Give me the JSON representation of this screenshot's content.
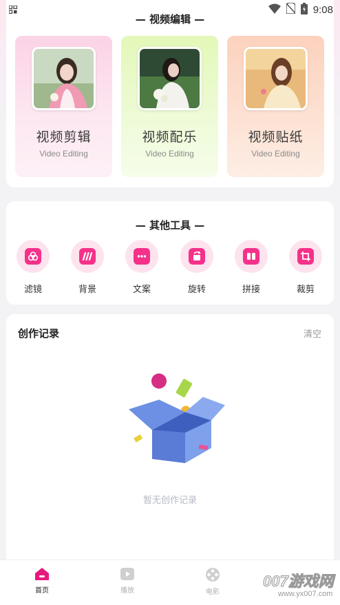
{
  "status_bar": {
    "time": "9:08",
    "icons": [
      "grid-icon",
      "wifi-icon",
      "no-sim-icon",
      "battery-icon"
    ]
  },
  "video_editing": {
    "title": "— 视频编辑 —",
    "features": [
      {
        "title": "视频剪辑",
        "subtitle": "Video Editing",
        "bg": "#fbd3e6"
      },
      {
        "title": "视频配乐",
        "subtitle": "Video Editing",
        "bg": "#e3f8b8"
      },
      {
        "title": "视频贴纸",
        "subtitle": "Video Editing",
        "bg": "#fcd2bd"
      }
    ]
  },
  "other_tools": {
    "title": "— 其他工具 —",
    "tools": [
      {
        "label": "滤镜",
        "icon": "filter-icon"
      },
      {
        "label": "背景",
        "icon": "background-icon"
      },
      {
        "label": "文案",
        "icon": "text-icon"
      },
      {
        "label": "旋转",
        "icon": "rotate-icon"
      },
      {
        "label": "拼接",
        "icon": "splice-icon"
      },
      {
        "label": "裁剪",
        "icon": "crop-icon"
      }
    ]
  },
  "records": {
    "title": "创作记录",
    "clear_label": "清空",
    "empty_text": "暂无创作记录"
  },
  "tab_bar": {
    "tabs": [
      {
        "label": "首页",
        "icon": "home-icon",
        "active": true
      },
      {
        "label": "播放",
        "icon": "play-icon",
        "active": false
      },
      {
        "label": "电影",
        "icon": "film-reel-icon",
        "active": false
      }
    ]
  },
  "watermark": {
    "line1": "007游戏网",
    "line2": "www.yx007.com"
  },
  "colors": {
    "accent": "#f5318a",
    "page_bg": "#f3f2f5"
  }
}
